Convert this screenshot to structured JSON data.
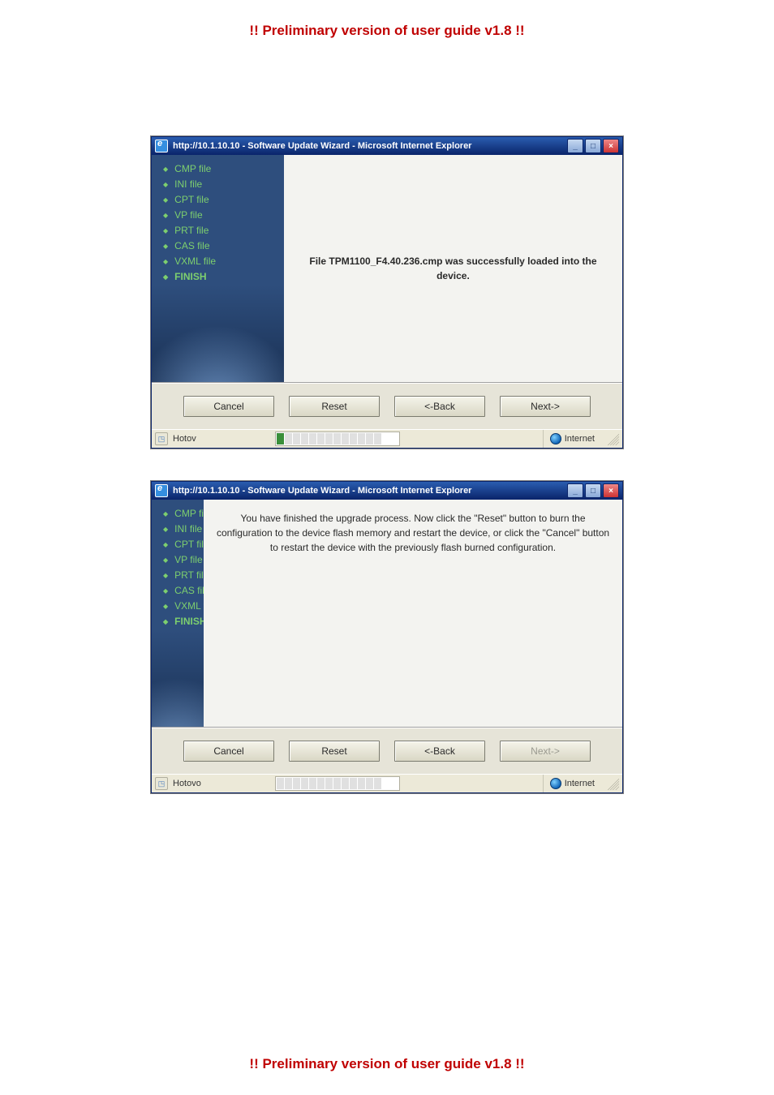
{
  "header": "!! Preliminary version of user guide v1.8 !!",
  "footer": "!! Preliminary version of user guide v1.8 !!",
  "window_title": "http://10.1.10.10 - Software Update Wizard - Microsoft Internet Explorer",
  "side_items": [
    "CMP file",
    "INI file",
    "CPT file",
    "VP file",
    "PRT file",
    "CAS file",
    "VXML file",
    "FINISH"
  ],
  "screens": [
    {
      "message": "File TPM1100_F4.40.236.cmp was successfully loaded into the device.",
      "buttons": {
        "cancel": {
          "label": "Cancel",
          "enabled": true
        },
        "reset": {
          "label": "Reset",
          "enabled": true
        },
        "back": {
          "label": "<-Back",
          "enabled": true
        },
        "next": {
          "label": "Next->",
          "enabled": true
        }
      },
      "status_text": "Hotov",
      "status_progress": true,
      "zone": "Internet",
      "active_index": 7
    },
    {
      "message": "You have finished the upgrade process. Now click the \"Reset\" button to burn the configuration to the device flash memory and restart the device, or click the \"Cancel\" button to restart the device with the previously flash burned configuration.",
      "buttons": {
        "cancel": {
          "label": "Cancel",
          "enabled": true
        },
        "reset": {
          "label": "Reset",
          "enabled": true
        },
        "back": {
          "label": "<-Back",
          "enabled": true
        },
        "next": {
          "label": "Next->",
          "enabled": false
        }
      },
      "status_text": "Hotovo",
      "status_progress": false,
      "zone": "Internet",
      "active_index": 7
    }
  ]
}
